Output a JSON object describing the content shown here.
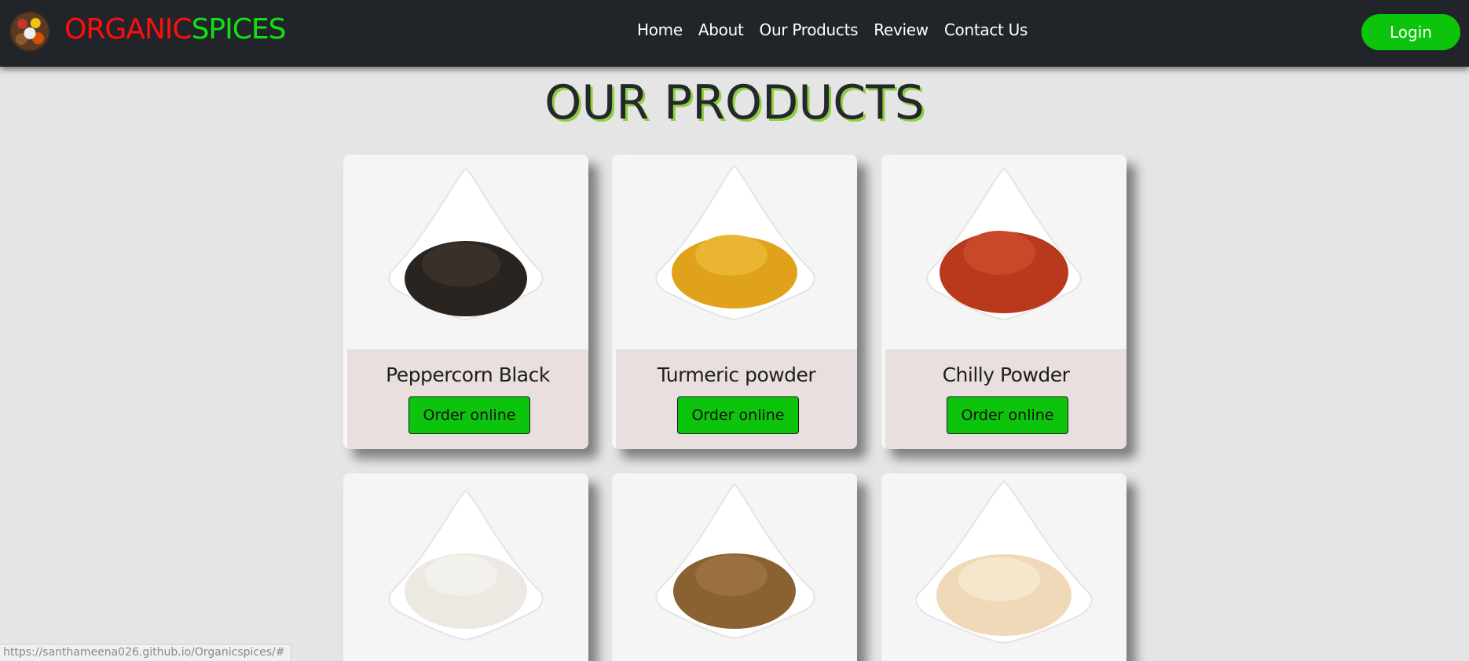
{
  "brand": {
    "part1": "ORGANIC",
    "part2": "SPICES",
    "logo_icon": "spices-logo"
  },
  "nav": {
    "items": [
      {
        "label": "Home"
      },
      {
        "label": "About"
      },
      {
        "label": "Our Products"
      },
      {
        "label": "Review"
      },
      {
        "label": "Contact Us"
      }
    ],
    "login_label": "Login"
  },
  "section": {
    "title": "OUR PRODUCTS"
  },
  "products": [
    {
      "name": "Peppercorn Black",
      "button": "Order online",
      "color": "#2a2420"
    },
    {
      "name": "Turmeric powder",
      "button": "Order online",
      "color": "#e0a21a"
    },
    {
      "name": "Chilly Powder",
      "button": "Order online",
      "color": "#b8391c"
    },
    {
      "name": "",
      "button": "",
      "color": "#ece9e2"
    },
    {
      "name": "",
      "button": "",
      "color": "#8a6232"
    },
    {
      "name": "",
      "button": "",
      "color": "#efd9b8"
    }
  ],
  "status_bar": {
    "url": "https://santhameena026.github.io/Organicspices/#"
  },
  "colors": {
    "navbar": "#212529",
    "accent_green": "#0cc40c",
    "brand_red": "#ff0d0d",
    "brand_green": "#12e012"
  }
}
